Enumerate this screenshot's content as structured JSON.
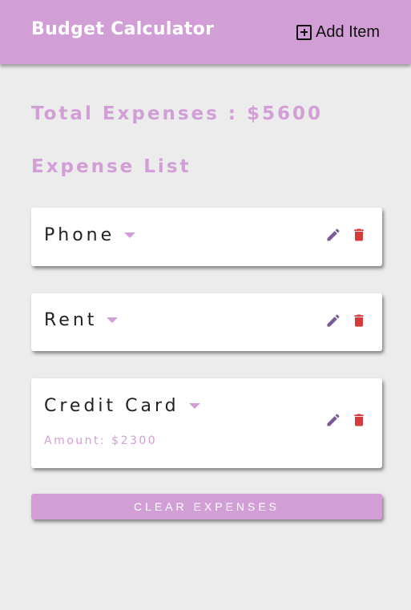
{
  "header": {
    "title": "Budget Calculator",
    "add_item_label": "Add Item"
  },
  "summary": {
    "total_label": "Total Expenses : $5600",
    "list_title": "Expense List"
  },
  "expenses": [
    {
      "name": "Phone",
      "expanded": false
    },
    {
      "name": "Rent",
      "expanded": false
    },
    {
      "name": "Credit Card",
      "expanded": true,
      "amount_label": "Amount: $2300"
    }
  ],
  "actions": {
    "clear_label": "CLEAR EXPENSES"
  },
  "icons": {
    "add": "plus-square-icon",
    "expand": "caret-down-icon",
    "edit": "pencil-icon",
    "delete": "trash-icon"
  },
  "colors": {
    "accent": "#d19fd5",
    "edit": "#7a5a99",
    "delete": "#d43a3a",
    "background": "#ececec"
  }
}
